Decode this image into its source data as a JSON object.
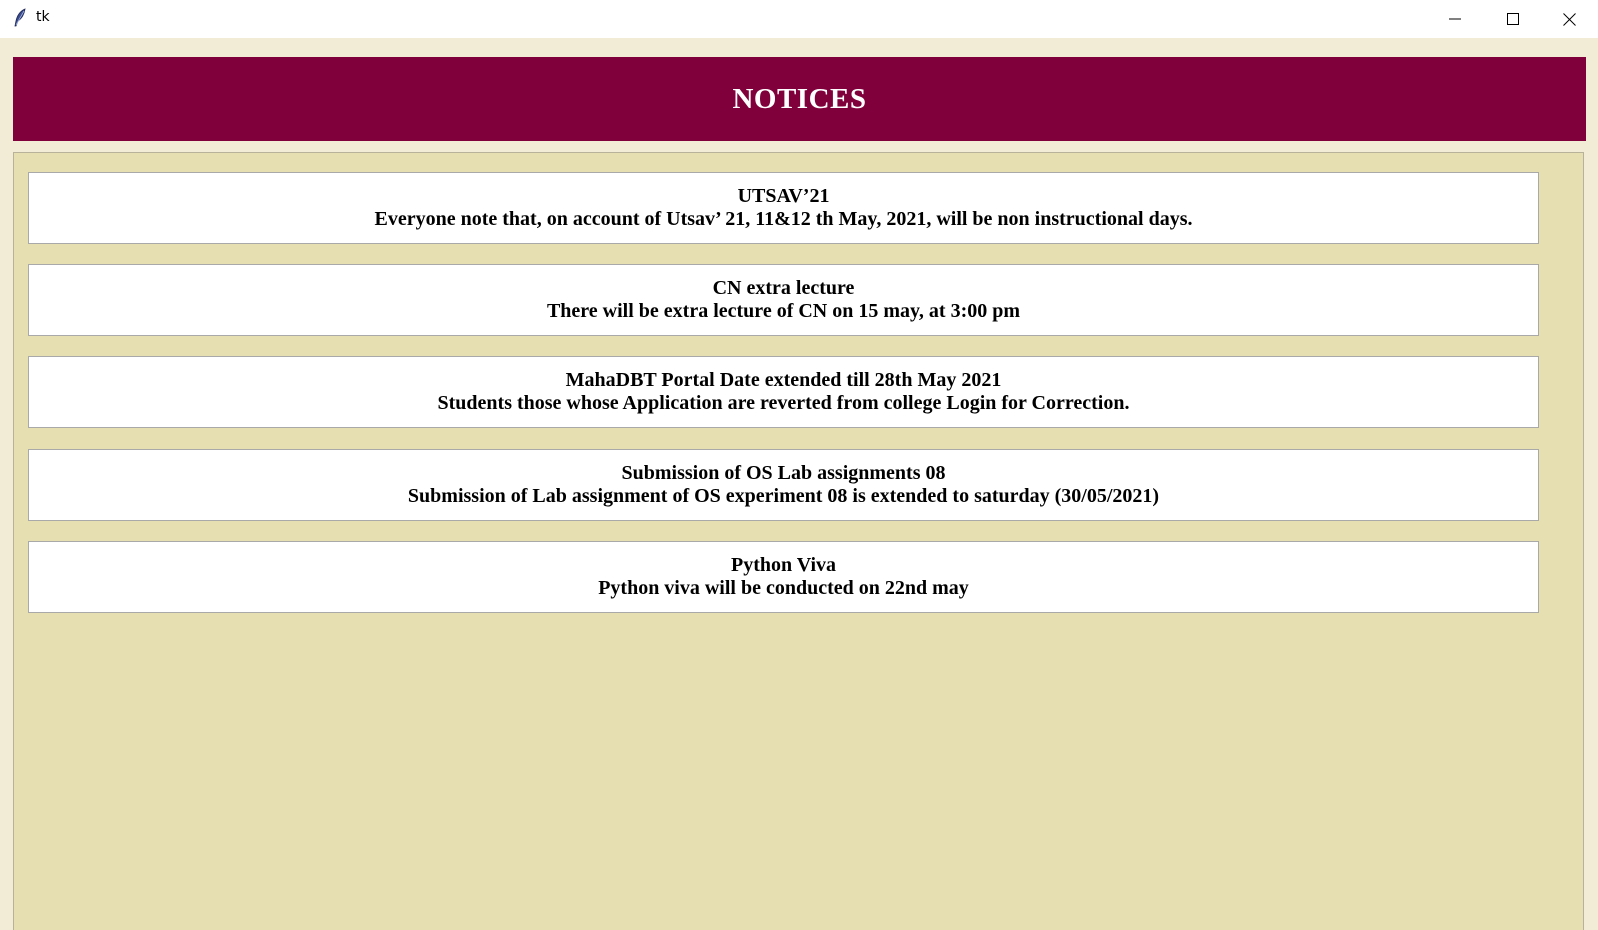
{
  "window": {
    "title": "tk",
    "icon": "feather-icon",
    "controls": [
      "minimize-icon",
      "maximize-icon",
      "close-icon"
    ]
  },
  "header": {
    "title": "NOTICES",
    "background_color": "#80003c"
  },
  "content": {
    "background_color": "#e6dfb1"
  },
  "notices": [
    {
      "title": "UTSAV’21",
      "body": "Everyone note that, on account of Utsav’ 21, 11&12 th May, 2021, will be non instructional days."
    },
    {
      "title": "CN extra lecture",
      "body": "There will be extra lecture of CN on 15 may, at 3:00 pm"
    },
    {
      "title": "MahaDBT Portal Date extended till 28th May 2021",
      "body": "Students those whose Application are reverted from college Login for Correction."
    },
    {
      "title": "Submission of OS Lab assignments 08",
      "body": "Submission of Lab assignment of OS experiment 08 is extended to saturday (30/05/2021)"
    },
    {
      "title": "Python Viva",
      "body": "Python viva will be conducted on 22nd may"
    }
  ]
}
